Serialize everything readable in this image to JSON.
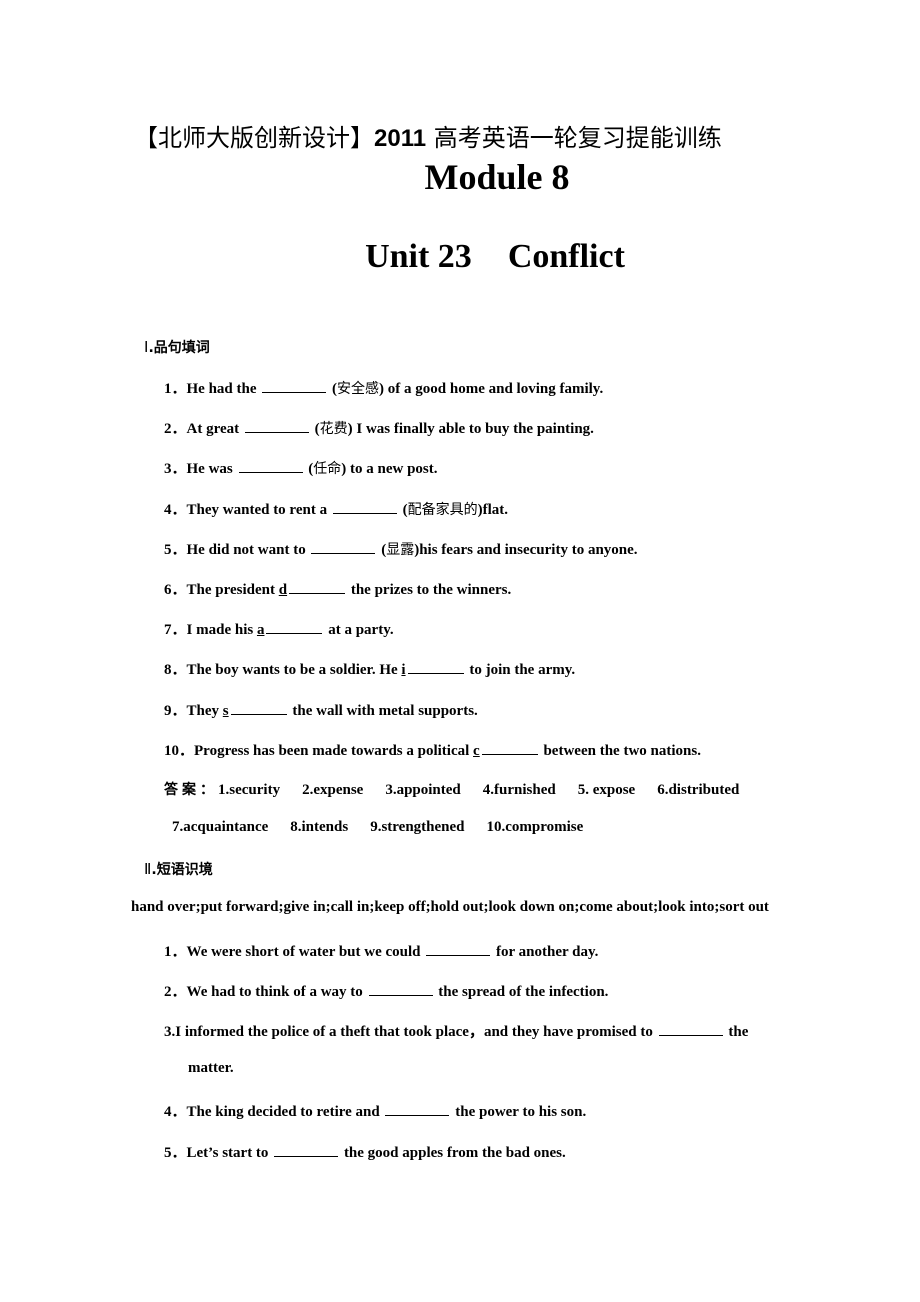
{
  "header": {
    "banner_prefix": "【北师大版创新设计】",
    "banner_year": "2011",
    "banner_suffix": " 高考英语一轮复习提能训练",
    "module": "Module 8",
    "unit_number": "Unit 23",
    "unit_title": "Conflict"
  },
  "section1": {
    "roman": "Ⅰ",
    "title": ".品句填词",
    "items": [
      {
        "num": "1．",
        "before": "He had the ",
        "first": "",
        "hint": "(安全感)",
        "after": " of a good home and loving family."
      },
      {
        "num": "2．",
        "before": "At great ",
        "first": "",
        "hint": "(花费)",
        "after": " I was finally able to buy the painting."
      },
      {
        "num": "3．",
        "before": "He was ",
        "first": "",
        "hint": "(任命)",
        "after": " to a new post."
      },
      {
        "num": "4．",
        "before": "They wanted to rent a ",
        "first": "",
        "hint": "(配备家具的)",
        "after": "flat."
      },
      {
        "num": "5．",
        "before": "He did not want to ",
        "first": "",
        "hint": "(显露)",
        "after": "his fears and insecurity to anyone."
      },
      {
        "num": "6．",
        "before": "The president ",
        "first": "d",
        "hint": "",
        "after": " the prizes to the winners."
      },
      {
        "num": "7．",
        "before": "I made his ",
        "first": "a",
        "hint": "",
        "after": " at a party."
      },
      {
        "num": "8．",
        "before": "The boy wants to be a soldier. He ",
        "first": "i",
        "hint": "",
        "after": " to join the army."
      },
      {
        "num": "9．",
        "before": "They ",
        "first": "s",
        "hint": "",
        "after": " the wall with metal supports."
      },
      {
        "num": "10．",
        "before": "Progress has been made towards a political ",
        "first": "c",
        "hint": "",
        "after": " between the two nations."
      }
    ],
    "answer_label": "答案：",
    "answers_line1": [
      "1.security",
      "2.expense",
      "3.appointed",
      "4.furnished",
      "5. expose",
      "6.distributed"
    ],
    "answers_line2": [
      "7.acquaintance",
      "8.intends",
      "9.strengthened",
      "10.compromise"
    ]
  },
  "section2": {
    "roman": "Ⅱ",
    "title": ".短语识境",
    "phrase_bank": "hand over;put forward;give in;call in;keep off;hold out;look down on;come about;look into;sort out",
    "items": [
      {
        "num": "1．",
        "before": "We were short of water but we could ",
        "after": " for another day."
      },
      {
        "num": "2．",
        "before": "We had to think of a way to ",
        "after": " the spread of the infection."
      },
      {
        "num": "3. ",
        "before": "I informed the police of a theft that took place，and they have promised to ",
        "after": " the",
        "continuation": "matter."
      },
      {
        "num": "4．",
        "before": "The king decided to retire and ",
        "after": " the power to his son."
      },
      {
        "num": "5．",
        "before": "Let’s start to ",
        "after": " the good apples from the bad ones."
      }
    ]
  }
}
